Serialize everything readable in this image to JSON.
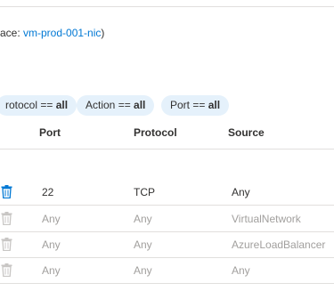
{
  "interface": {
    "prefix": "ace: ",
    "name": "vm-prod-001-nic",
    "suffix": ")"
  },
  "filters": [
    {
      "name": "rotocol",
      "op": " == ",
      "value": "all"
    },
    {
      "name": "Action",
      "op": " == ",
      "value": "all"
    },
    {
      "name": "Port",
      "op": " == ",
      "value": "all"
    }
  ],
  "columns": {
    "port": "Port",
    "protocol": "Protocol",
    "source": "Source"
  },
  "rows": [
    {
      "port": "22",
      "protocol": "TCP",
      "source": "Any"
    },
    {
      "port": "Any",
      "protocol": "Any",
      "source": "VirtualNetwork"
    },
    {
      "port": "Any",
      "protocol": "Any",
      "source": "AzureLoadBalancer"
    },
    {
      "port": "Any",
      "protocol": "Any",
      "source": "Any"
    }
  ],
  "colors": {
    "link": "#0078d4",
    "pill_bg": "#e5f1fb",
    "muted_text": "#a19f9d",
    "trash_active": "#0078d4",
    "trash_muted": "#c8c6c4"
  }
}
